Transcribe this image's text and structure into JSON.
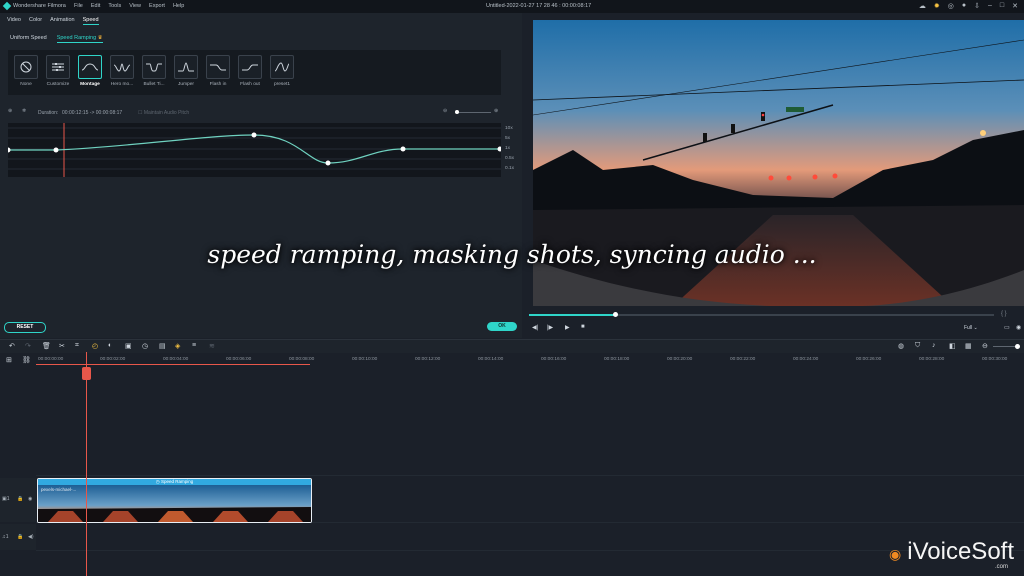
{
  "titlebar": {
    "app_name": "Wondershare Filmora",
    "menu": [
      "File",
      "Edit",
      "Tools",
      "View",
      "Export",
      "Help"
    ],
    "document": "Untitled-2022-01-27 17 28 46 : 00:00:08:17"
  },
  "tabs": [
    "Video",
    "Color",
    "Animation",
    "Speed"
  ],
  "subtabs": {
    "uniform": "Uniform Speed",
    "ramping": "Speed Ramping"
  },
  "presets": [
    "None",
    "Customize",
    "Montage",
    "Hero mo...",
    "Bullet Ti...",
    "Jumper",
    "Flash in",
    "Flash out",
    "preset1"
  ],
  "duration": {
    "label": "Duration:",
    "value": "00:00:12:15 -> 00:00:08:17",
    "maintain_pitch": "Maintain Audio Pitch"
  },
  "speed_levels": [
    "10x",
    "5x",
    "1x",
    "0.5x",
    "0.1x"
  ],
  "buttons": {
    "reset": "RESET",
    "ok": "OK"
  },
  "player": {
    "quality": "Full"
  },
  "timeline": {
    "ruler": [
      "00:00:00:00",
      "00:00:02:00",
      "00:00:04:00",
      "00:00:06:00",
      "00:00:08:00",
      "00:00:10:00",
      "00:00:12:00",
      "00:00:14:00",
      "00:00:16:00",
      "00:00:18:00",
      "00:00:20:00",
      "00:00:22:00",
      "00:00:24:00",
      "00:00:26:00",
      "00:00:28:00",
      "00:00:30:00"
    ],
    "clip_title": "Speed Ramping",
    "clip_name": "pexels-michael-...",
    "video_track": "1",
    "audio_track": "1"
  },
  "overlay_caption": "speed ramping, masking shots, syncing audio ...",
  "watermark": {
    "name": "iVoiceSoft",
    "sub": ".com"
  },
  "colors": {
    "accent": "#2fd5c9",
    "playhead": "#e8574a",
    "clip_bar": "#31a9e0"
  }
}
